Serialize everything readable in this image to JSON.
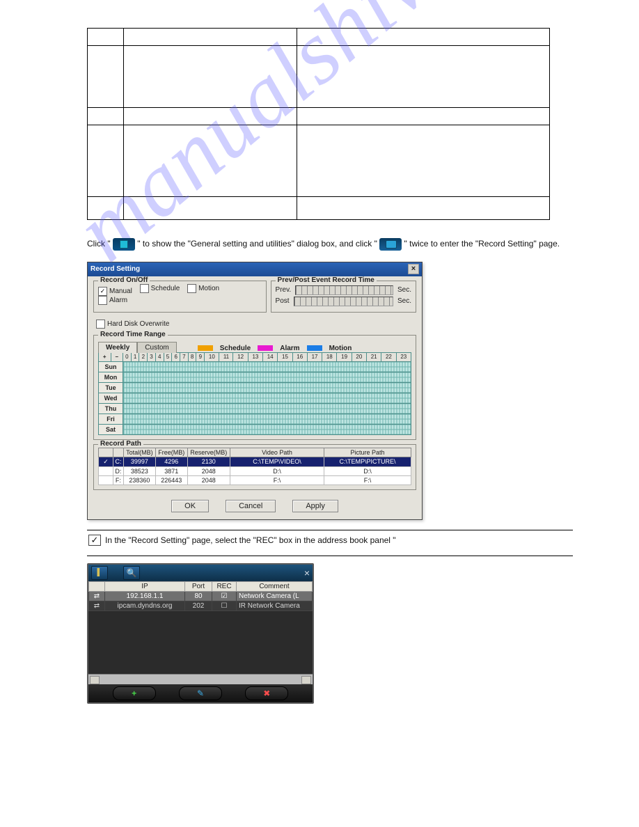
{
  "watermark": "manualshive.com",
  "para_prefix": "Click \"",
  "para_mid1": "\" to show the \"General setting and utilities\" dialog box, and click \"",
  "para_mid2": "\" twice to enter the \"Record Setting\" page.",
  "dlg": {
    "title": "Record Setting",
    "grp_onoff": "Record On/Off",
    "chk_manual": "Manual",
    "chk_schedule": "Schedule",
    "chk_motion": "Motion",
    "chk_alarm": "Alarm",
    "chk_hdd": "Hard Disk Overwrite",
    "grp_evt": "Prev/Post Event Record Time",
    "lbl_prev": "Prev.",
    "lbl_post": "Post",
    "sec": "Sec.",
    "grp_range": "Record Time Range",
    "tab_weekly": "Weekly",
    "tab_custom": "Custom",
    "leg_schedule": "Schedule",
    "leg_alarm": "Alarm",
    "leg_motion": "Motion",
    "days": [
      "Sun",
      "Mon",
      "Tue",
      "Wed",
      "Thu",
      "Fri",
      "Sat"
    ],
    "hours": [
      "0",
      "1",
      "2",
      "3",
      "4",
      "5",
      "6",
      "7",
      "8",
      "9",
      "10",
      "11",
      "12",
      "13",
      "14",
      "15",
      "16",
      "17",
      "18",
      "19",
      "20",
      "21",
      "22",
      "23"
    ],
    "grp_path": "Record Path",
    "path_headers": [
      "",
      "",
      "Total(MB)",
      "Free(MB)",
      "Reserve(MB)",
      "Video Path",
      "Picture Path"
    ],
    "path_rows": [
      {
        "sel": true,
        "chk": true,
        "drive": "C:",
        "total": "39997",
        "free": "4296",
        "reserve": "2130",
        "video": "C:\\TEMP\\VIDEO\\",
        "picture": "C:\\TEMP\\PICTURE\\"
      },
      {
        "sel": false,
        "chk": false,
        "drive": "D:",
        "total": "38523",
        "free": "3871",
        "reserve": "2048",
        "video": "D:\\",
        "picture": "D:\\"
      },
      {
        "sel": false,
        "chk": false,
        "drive": "F:",
        "total": "238360",
        "free": "226443",
        "reserve": "2048",
        "video": "F:\\",
        "picture": "F:\\"
      }
    ],
    "btn_ok": "OK",
    "btn_cancel": "Cancel",
    "btn_apply": "Apply"
  },
  "note_after": "In the \"Record Setting\" page, select the \"REC\" box in the address book panel \"",
  "abook": {
    "headers": [
      "",
      "IP",
      "Port",
      "REC",
      "Comment"
    ],
    "rows": [
      {
        "sel": true,
        "ip": "192.168.1.1",
        "port": "80",
        "rec": true,
        "comment": "Network Camera (L"
      },
      {
        "sel": false,
        "ip": "ipcam.dyndns.org",
        "port": "202",
        "rec": false,
        "comment": "IR Network Camera"
      }
    ]
  }
}
